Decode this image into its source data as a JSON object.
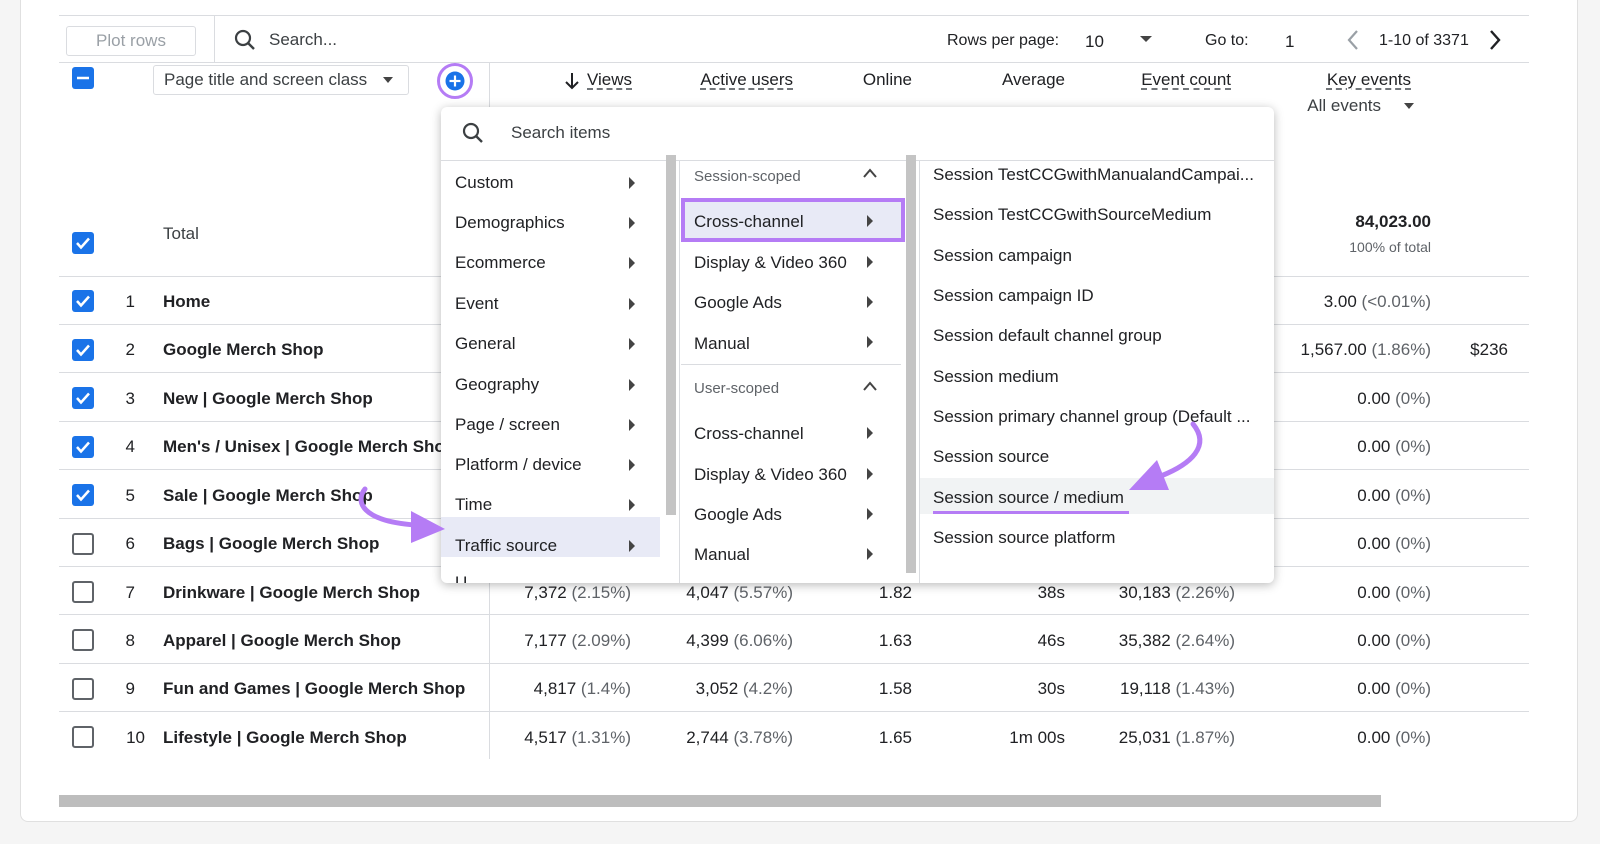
{
  "toolbar": {
    "plot_rows_label": "Plot rows",
    "search_placeholder": "Search...",
    "rows_per_page_label": "Rows per page:",
    "rows_per_page_value": "10",
    "goto_label": "Go to:",
    "goto_value": "1",
    "pagination_range": "1-10 of 3371"
  },
  "header": {
    "dimension_select": "Page title and screen class",
    "columns": [
      {
        "label": "Views",
        "sorted": true
      },
      {
        "label": "Active users"
      },
      {
        "label": "Online"
      },
      {
        "label": "Average"
      },
      {
        "label": "Event count"
      },
      {
        "label": "Key events",
        "sub": "All events"
      }
    ]
  },
  "total": {
    "label": "Total",
    "event_count": "84,023.00",
    "event_count_pct": "100% of total"
  },
  "rows": [
    {
      "num": "1",
      "title": "Home",
      "views": "",
      "views_pct": "",
      "users": "",
      "users_pct": "",
      "online": "",
      "avg": "",
      "events": "",
      "events_pct": "",
      "key": "3.00",
      "key_pct": "(<0.01%)",
      "extra": "",
      "checked": true
    },
    {
      "num": "2",
      "title": "Google Merch Shop",
      "views": "",
      "views_pct": "",
      "users": "",
      "users_pct": "",
      "online": "",
      "avg": "",
      "events": "",
      "events_pct": "",
      "key": "1,567.00",
      "key_pct": "(1.86%)",
      "extra": "$236",
      "checked": true
    },
    {
      "num": "3",
      "title": "New | Google Merch Shop",
      "views": "",
      "views_pct": "",
      "users": "",
      "users_pct": "",
      "online": "",
      "avg": "",
      "events": "",
      "events_pct": "",
      "key": "0.00",
      "key_pct": "(0%)",
      "extra": "",
      "checked": true
    },
    {
      "num": "4",
      "title": "Men's / Unisex | Google Merch Shop",
      "views": "",
      "views_pct": "",
      "users": "",
      "users_pct": "",
      "online": "",
      "avg": "",
      "events": "",
      "events_pct": "",
      "key": "0.00",
      "key_pct": "(0%)",
      "extra": "",
      "checked": true
    },
    {
      "num": "5",
      "title": "Sale | Google Merch Shop",
      "views": "",
      "views_pct": "",
      "users": "",
      "users_pct": "",
      "online": "",
      "avg": "",
      "events": "",
      "events_pct": "",
      "key": "0.00",
      "key_pct": "(0%)",
      "extra": "",
      "checked": true
    },
    {
      "num": "6",
      "title": "Bags | Google Merch Shop",
      "views": "",
      "views_pct": "",
      "users": "",
      "users_pct": "",
      "online": "",
      "avg": "",
      "events": "",
      "events_pct": "",
      "key": "0.00",
      "key_pct": "(0%)",
      "extra": "",
      "checked": false
    },
    {
      "num": "7",
      "title": "Drinkware | Google Merch Shop",
      "views": "7,372",
      "views_pct": "(2.15%)",
      "users": "4,047",
      "users_pct": "(5.57%)",
      "online": "1.82",
      "avg": "38s",
      "events": "30,183",
      "events_pct": "(2.26%)",
      "key": "0.00",
      "key_pct": "(0%)",
      "extra": "",
      "checked": false
    },
    {
      "num": "8",
      "title": "Apparel | Google Merch Shop",
      "views": "7,177",
      "views_pct": "(2.09%)",
      "users": "4,399",
      "users_pct": "(6.06%)",
      "online": "1.63",
      "avg": "46s",
      "events": "35,382",
      "events_pct": "(2.64%)",
      "key": "0.00",
      "key_pct": "(0%)",
      "extra": "",
      "checked": false
    },
    {
      "num": "9",
      "title": "Fun and Games | Google Merch Shop",
      "views": "4,817",
      "views_pct": "(1.4%)",
      "users": "3,052",
      "users_pct": "(4.2%)",
      "online": "1.58",
      "avg": "30s",
      "events": "19,118",
      "events_pct": "(1.43%)",
      "key": "0.00",
      "key_pct": "(0%)",
      "extra": "",
      "checked": false
    },
    {
      "num": "10",
      "title": "Lifestyle | Google Merch Shop",
      "views": "4,517",
      "views_pct": "(1.31%)",
      "users": "2,744",
      "users_pct": "(3.78%)",
      "online": "1.65",
      "avg": "1m 00s",
      "events": "25,031",
      "events_pct": "(1.87%)",
      "key": "0.00",
      "key_pct": "(0%)",
      "extra": "",
      "checked": false
    }
  ],
  "dropdown": {
    "search_placeholder": "Search items",
    "categories": [
      "Custom",
      "Demographics",
      "Ecommerce",
      "Event",
      "General",
      "Geography",
      "Page / screen",
      "Platform / device",
      "Time",
      "Traffic source",
      "U"
    ],
    "session_scoped_label": "Session-scoped",
    "session_items": [
      "Cross-channel",
      "Display & Video 360",
      "Google Ads",
      "Manual"
    ],
    "user_scoped_label": "User-scoped",
    "user_items": [
      "Cross-channel",
      "Display & Video 360",
      "Google Ads",
      "Manual"
    ],
    "options": [
      "Session TestCCGwithManualandCampai...",
      "Session TestCCGwithSourceMedium",
      "Session campaign",
      "Session campaign ID",
      "Session default channel group",
      "Session medium",
      "Session primary channel group (Default ...",
      "Session source",
      "Session source / medium",
      "Session source platform"
    ]
  },
  "colors": {
    "accent": "#1a73e8",
    "highlight": "#b57cf5",
    "annotation": "#9b5de5"
  }
}
